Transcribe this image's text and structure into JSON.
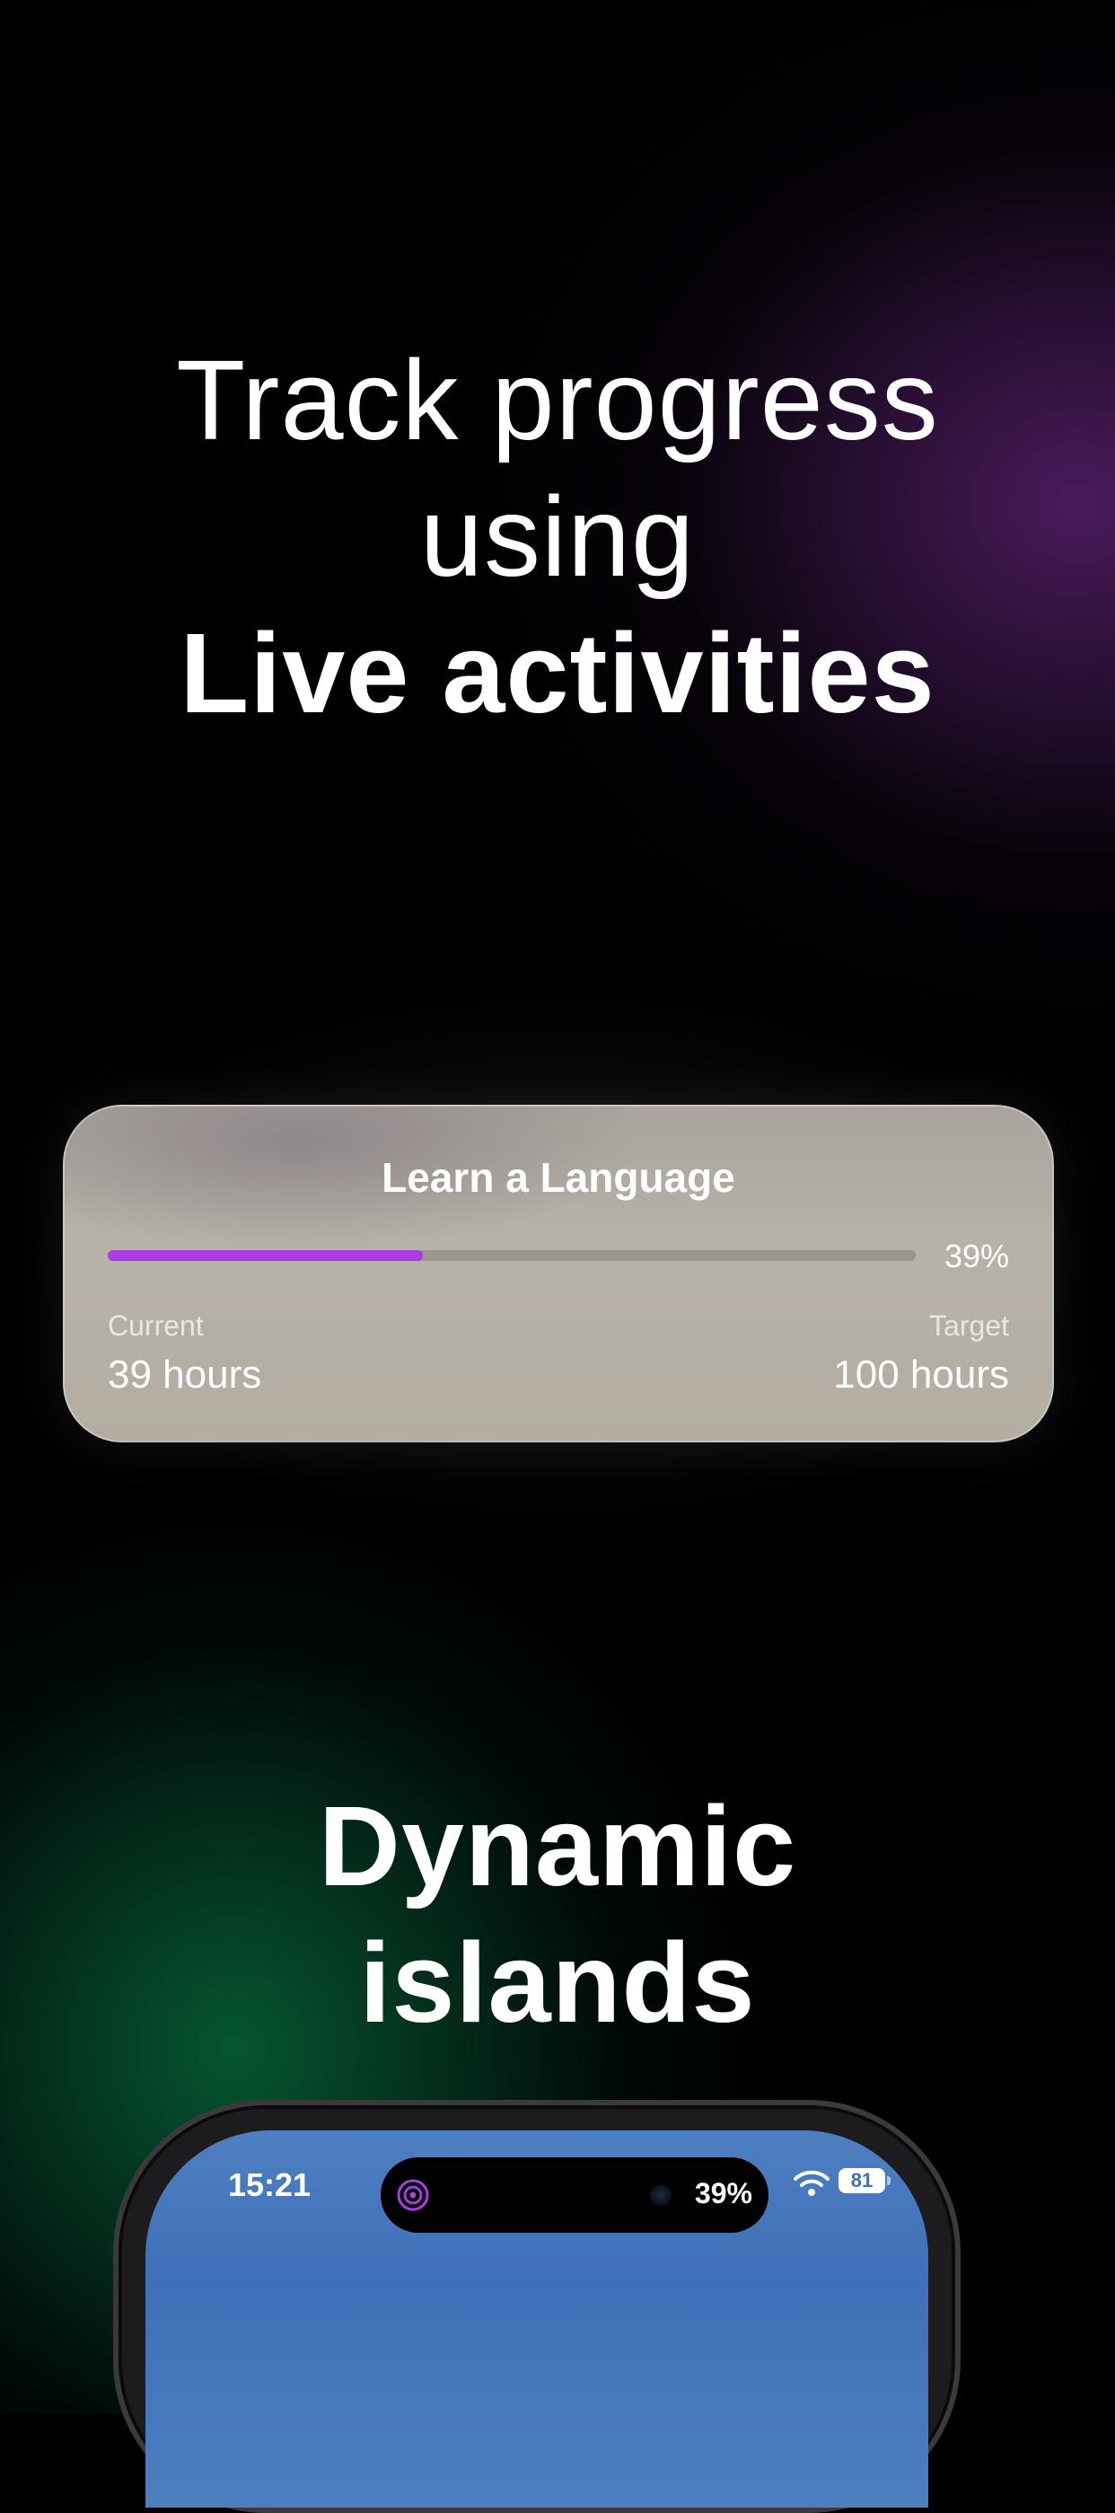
{
  "headline_top": {
    "line1": "Track progress",
    "line2": "using",
    "line3": "Live activities"
  },
  "live_activity": {
    "title": "Learn a Language",
    "progress_percent": 39,
    "progress_label": "39%",
    "current_label": "Current",
    "current_value": "39 hours",
    "target_label": "Target",
    "target_value": "100 hours",
    "accent_color": "#a83de2"
  },
  "headline_bottom": {
    "line1": "Dynamic",
    "line2": "islands"
  },
  "phone": {
    "time": "15:21",
    "island_progress": "39%",
    "battery": "81",
    "icons": [
      "target-icon",
      "wifi-icon",
      "battery-icon"
    ],
    "screen_color": "#3e70b7"
  }
}
